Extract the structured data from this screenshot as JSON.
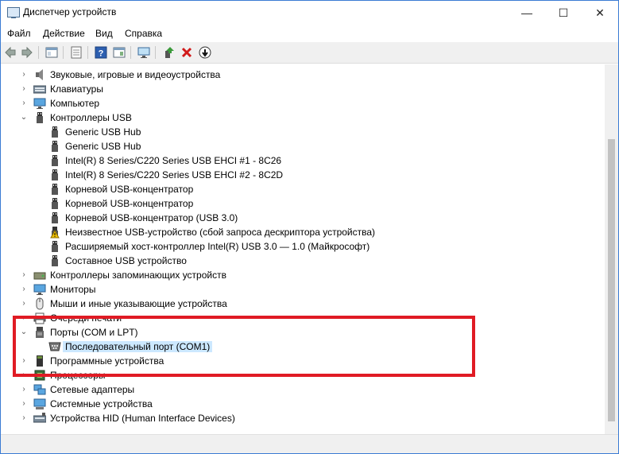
{
  "window": {
    "title": "Диспетчер устройств",
    "minimize_icon": "—",
    "maximize_icon": "☐",
    "close_icon": "✕"
  },
  "menu": [
    {
      "label": "Файл"
    },
    {
      "label": "Действие"
    },
    {
      "label": "Вид"
    },
    {
      "label": "Справка"
    }
  ],
  "toolbar": {
    "icons": [
      "back-arrow-icon",
      "forward-arrow-icon",
      "properties-pane-icon",
      "document-icon",
      "help-icon",
      "action-pane-icon",
      "monitor-scan-icon",
      "update-driver-icon",
      "remove-device-icon",
      "disable-device-icon"
    ],
    "colors": {
      "back": "#3b7c3b",
      "remove": "#d11a1a",
      "accent": "#1a66c9"
    }
  },
  "tree": {
    "items": [
      {
        "label": "Звуковые, игровые и видеоустройства",
        "expander": "›",
        "icon": "speaker-icon"
      },
      {
        "label": "Клавиатуры",
        "expander": "›",
        "icon": "keyboard-icon"
      },
      {
        "label": "Компьютер",
        "expander": "›",
        "icon": "computer-icon"
      },
      {
        "label": "Контроллеры USB",
        "expander": "⌄",
        "icon": "usb-icon"
      },
      {
        "label": "Generic USB Hub",
        "icon": "usb-icon"
      },
      {
        "label": "Generic USB Hub",
        "icon": "usb-icon"
      },
      {
        "label": "Intel(R) 8 Series/C220 Series USB EHCI #1 - 8C26",
        "icon": "usb-icon"
      },
      {
        "label": "Intel(R) 8 Series/C220 Series USB EHCI #2 - 8C2D",
        "icon": "usb-icon"
      },
      {
        "label": "Корневой USB-концентратор",
        "icon": "usb-icon"
      },
      {
        "label": "Корневой USB-концентратор",
        "icon": "usb-icon"
      },
      {
        "label": "Корневой USB-концентратор (USB 3.0)",
        "icon": "usb-icon"
      },
      {
        "label": "Неизвестное USB-устройство (сбой запроса дескриптора устройства)",
        "icon": "usb-warning-icon"
      },
      {
        "label": "Расширяемый хост-контроллер Intel(R) USB 3.0 — 1.0 (Майкрософт)",
        "icon": "usb-icon"
      },
      {
        "label": "Составное USB устройство",
        "icon": "usb-icon"
      },
      {
        "label": "Контроллеры запоминающих устройств",
        "expander": "›",
        "icon": "storage-icon"
      },
      {
        "label": "Мониторы",
        "expander": "›",
        "icon": "monitor-icon"
      },
      {
        "label": "Мыши и иные указывающие устройства",
        "expander": "›",
        "icon": "mouse-icon"
      },
      {
        "label": "Очереди печати",
        "expander": "›",
        "icon": "printer-icon"
      },
      {
        "label": "Порты (COM и LPT)",
        "expander": "⌄",
        "icon": "port-icon"
      },
      {
        "label": "Последовательный порт (COM1)",
        "icon": "serial-port-icon",
        "selected": true
      },
      {
        "label": "Программные устройства",
        "expander": "›",
        "icon": "software-device-icon"
      },
      {
        "label": "Процессоры",
        "expander": "›",
        "icon": "processor-icon"
      },
      {
        "label": "Сетевые адаптеры",
        "expander": "›",
        "icon": "network-icon"
      },
      {
        "label": "Системные устройства",
        "expander": "›",
        "icon": "system-icon"
      },
      {
        "label": "Устройства HID (Human Interface Devices)",
        "expander": "›",
        "icon": "hid-icon"
      }
    ]
  },
  "highlight_color": "#e01b24"
}
